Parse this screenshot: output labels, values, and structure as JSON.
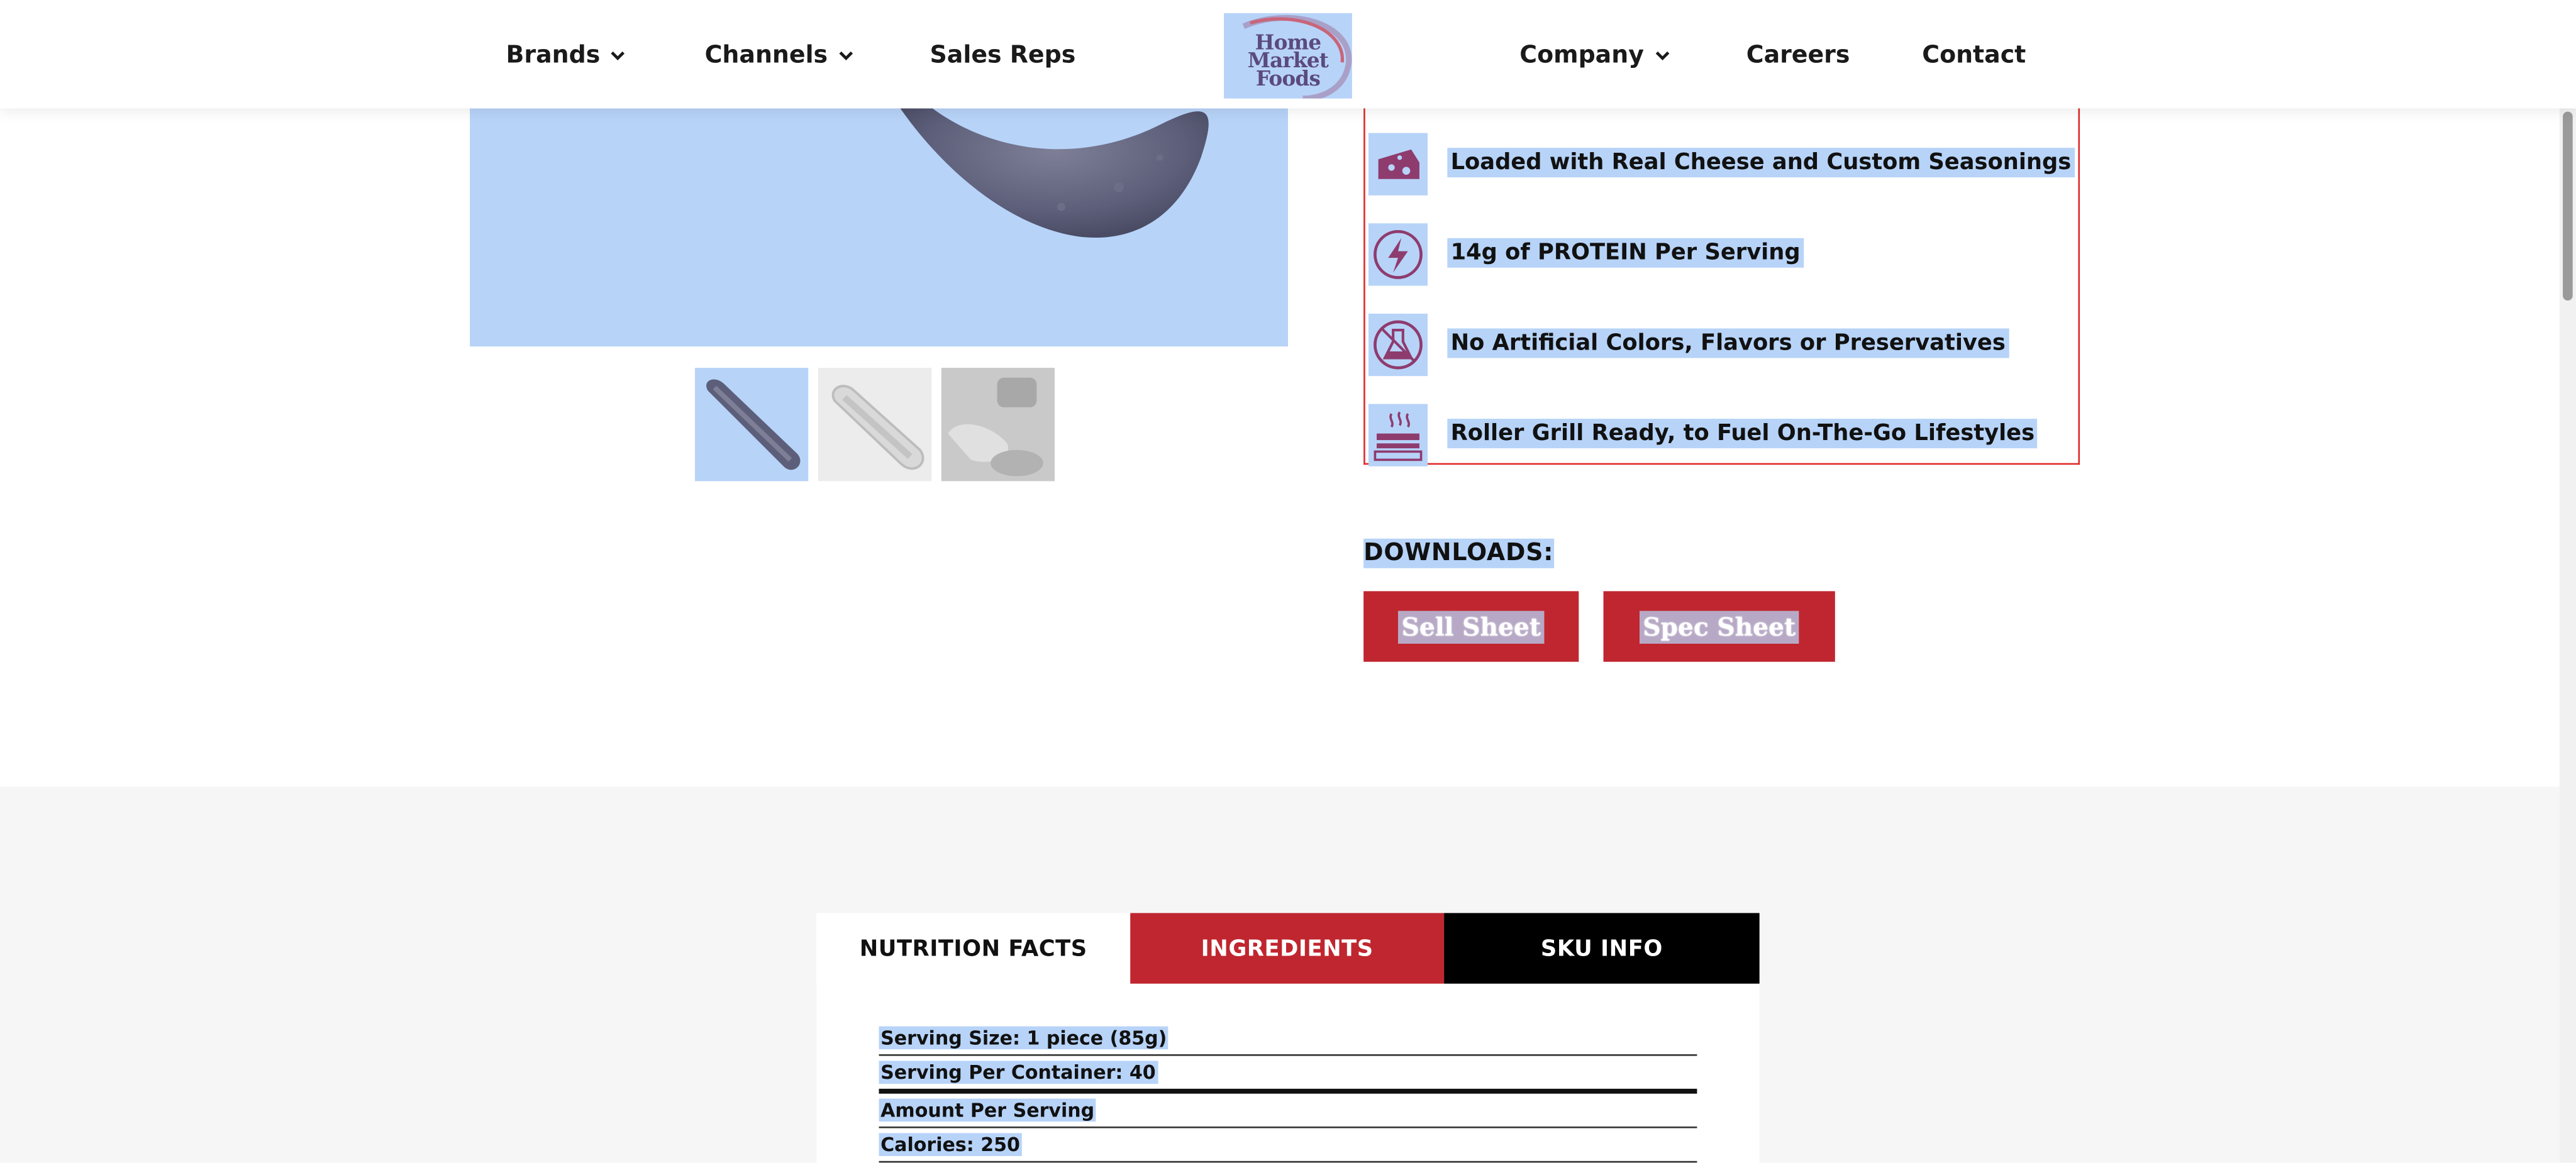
{
  "nav": {
    "brands": "Brands",
    "channels": "Channels",
    "sales_reps": "Sales Reps",
    "company": "Company",
    "careers": "Careers",
    "contact": "Contact"
  },
  "logo": {
    "line1": "Home",
    "line2": "Market",
    "line3": "Foods"
  },
  "features": [
    {
      "icon": "cheese-icon",
      "text": "Loaded with Real Cheese and Custom Seasonings"
    },
    {
      "icon": "lightning-bolt-icon",
      "text": "14g of PROTEIN Per Serving"
    },
    {
      "icon": "no-artificial-flask-icon",
      "text": "No Artificial Colors, Flavors or Preservatives"
    },
    {
      "icon": "roller-grill-icon",
      "text": "Roller Grill Ready, to Fuel On-The-Go Lifestyles"
    }
  ],
  "downloads": {
    "title": "DOWNLOADS:",
    "sell_sheet": "Sell Sheet",
    "spec_sheet": "Spec Sheet"
  },
  "tabs": {
    "nutrition": "NUTRITION FACTS",
    "ingredients": "INGREDIENTS",
    "sku": "SKU INFO"
  },
  "nutrition": {
    "serving_size": "Serving Size: 1 piece (85g)",
    "serving_per_container": "Serving Per Container: 40",
    "amount_per_serving": "Amount Per Serving",
    "calories": "Calories: 250"
  },
  "colors": {
    "brand_red": "#c0262f",
    "selection_blue": "#b7d3f8",
    "feature_border": "#e02a2a",
    "tab_black": "#000000"
  }
}
